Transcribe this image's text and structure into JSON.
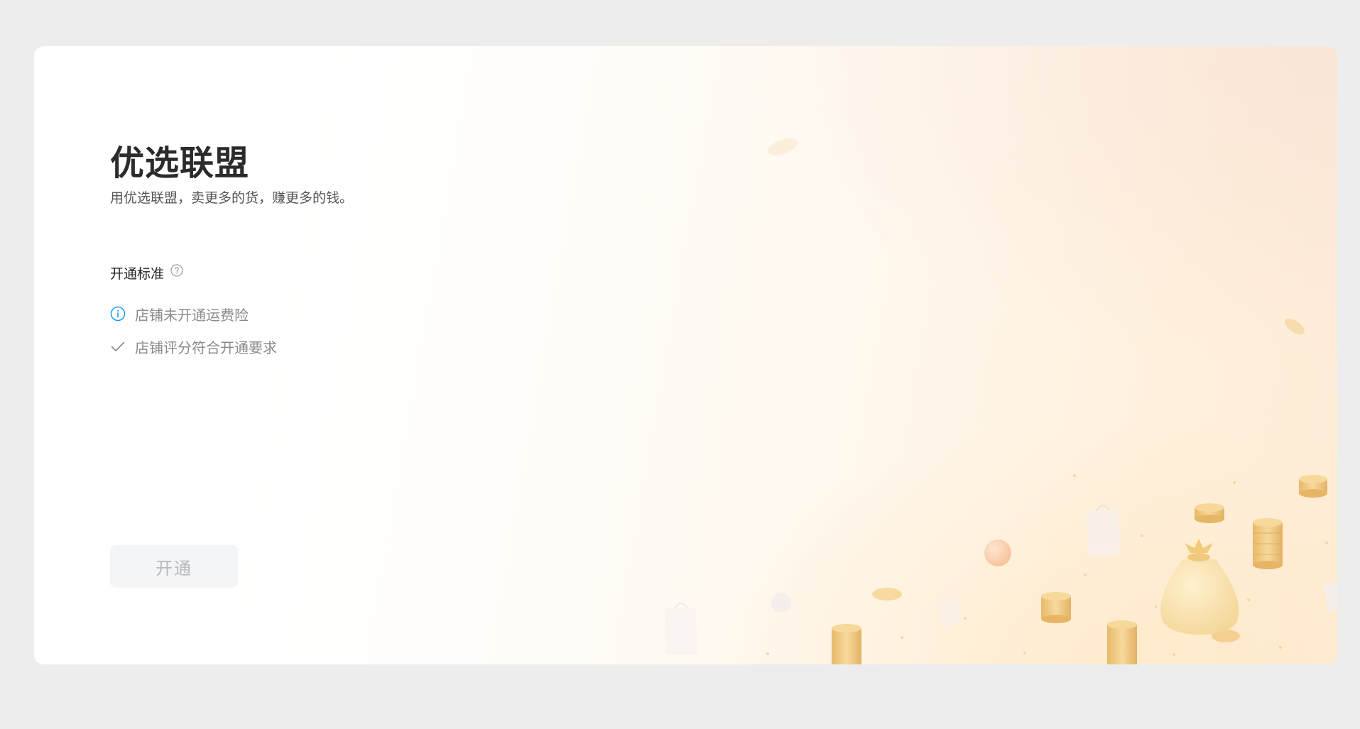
{
  "page": {
    "title": "优选联盟",
    "subtitle": "用优选联盟，卖更多的货，赚更多的钱。"
  },
  "criteria": {
    "heading": "开通标准",
    "help_icon": "question-circle-icon",
    "items": [
      {
        "text": "店铺未开通运费险",
        "icon": "info-circle-icon",
        "status": "unmet",
        "color": "#1a9cf0"
      },
      {
        "text": "店铺评分符合开通要求",
        "icon": "check-icon",
        "status": "met",
        "color": "#8a8a8a"
      }
    ]
  },
  "actions": {
    "open_label": "开通",
    "open_disabled": true
  },
  "colors": {
    "background": "#ededed",
    "card": "#ffffff",
    "accent_warm": "#fff0dc",
    "info_blue": "#1a9cf0",
    "coin_gold": "#f2cf8a"
  }
}
